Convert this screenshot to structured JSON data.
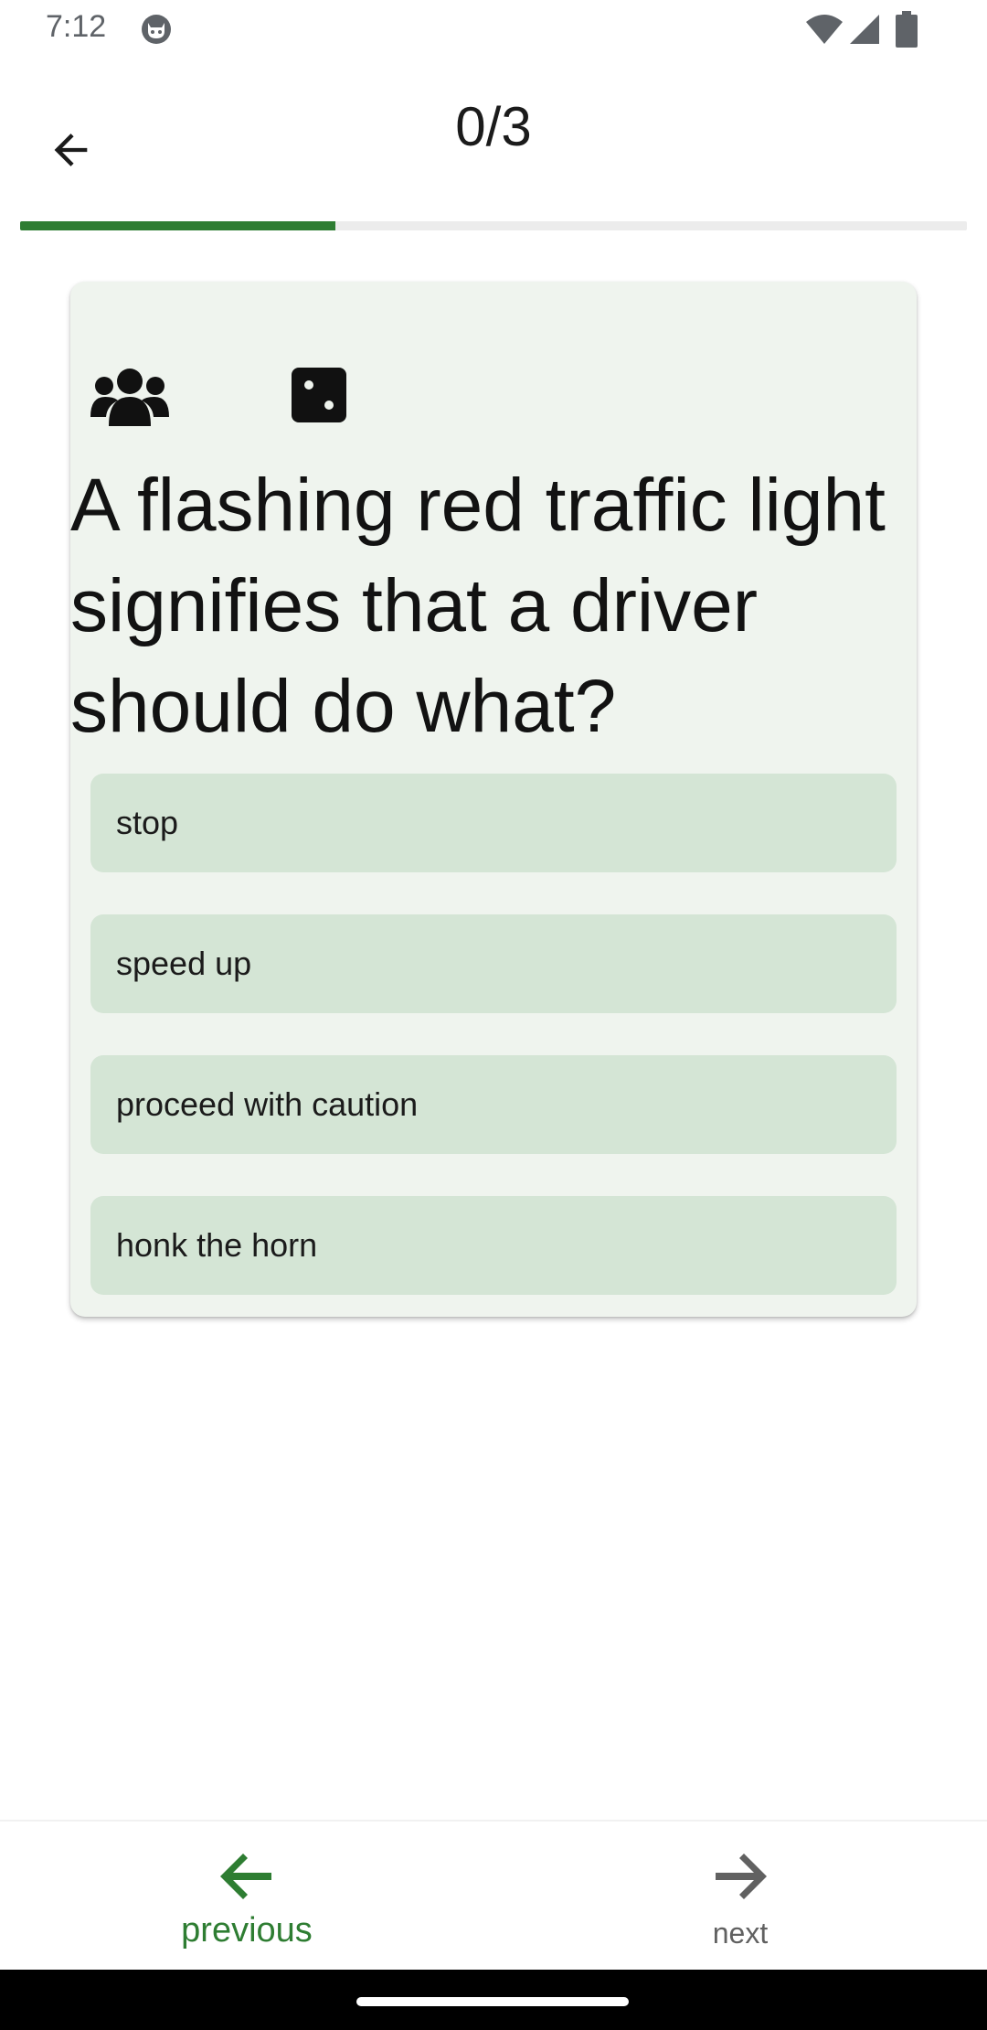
{
  "status_bar": {
    "time": "7:12",
    "icons": [
      "app-notification-icon",
      "wifi-icon",
      "cellular-icon",
      "battery-icon"
    ]
  },
  "app_bar": {
    "back_icon": "arrow-left-icon",
    "progress_label": "0/3"
  },
  "progress": {
    "fraction": 0.333,
    "fill_color": "#2e7d32",
    "track_color": "#ececec"
  },
  "card": {
    "category_icon": "group-icon",
    "difficulty_icon": "dice-icon",
    "question": "A flashing red traffic light signifies that a driver should do what?",
    "answers": [
      {
        "label": "stop"
      },
      {
        "label": "speed up"
      },
      {
        "label": "proceed with caution"
      },
      {
        "label": "honk the horn"
      }
    ],
    "background_color": "#eff4ee",
    "answer_color": "#d4e5d5"
  },
  "bottom_nav": {
    "previous": {
      "label": "previous",
      "icon": "arrow-left-icon",
      "color": "#2e7d32"
    },
    "next": {
      "label": "next",
      "icon": "arrow-right-icon",
      "color": "#616161"
    }
  }
}
